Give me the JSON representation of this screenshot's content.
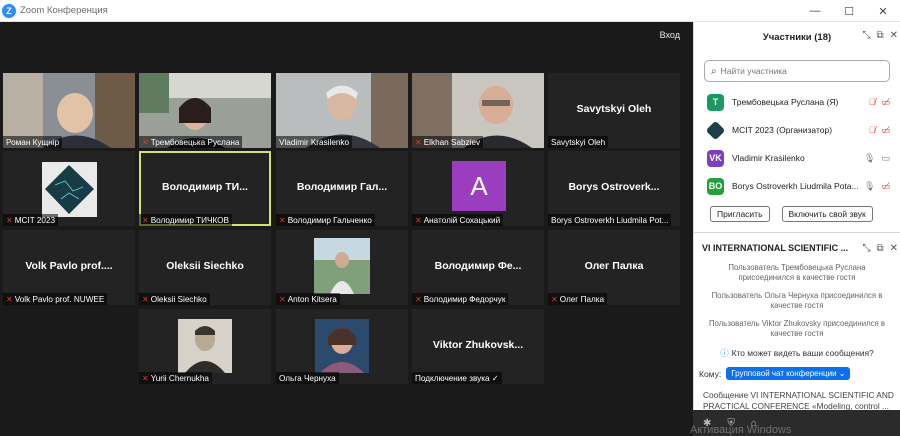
{
  "window": {
    "title": "Zoom Конференция",
    "logo_letter": "Z"
  },
  "video": {
    "enter_label": "Вход",
    "tiles": [
      {
        "big": "",
        "label": "Роман Кущнір",
        "muted": false
      },
      {
        "big": "",
        "label": "Трембовецька Руслана",
        "muted": true
      },
      {
        "big": "",
        "label": "Vladimir Krasilenko",
        "muted": false
      },
      {
        "big": "",
        "label": "Elkhan Sabziev",
        "muted": true
      },
      {
        "big": "Savytskyi Oleh",
        "label": "Savytskyi Oleh",
        "muted": false
      },
      {
        "big": "",
        "label": "MCIT 2023",
        "muted": true
      },
      {
        "big": "Володимир  ТИ...",
        "label": "Володимир ТИЧКОВ",
        "muted": true
      },
      {
        "big": "Володимир  Гал...",
        "label": "Володимир Гальченко",
        "muted": true
      },
      {
        "big": "",
        "label": "Анатолій Сохацький",
        "muted": true
      },
      {
        "big": "Borys  Ostroverk...",
        "label": "Borys Ostroverkh Liudmila Pot...",
        "muted": false
      },
      {
        "big": "Volk  Pavlo  prof....",
        "label": "Volk Pavlo prof. NUWEE",
        "muted": true
      },
      {
        "big": "Oleksii  Siechko",
        "label": "Oleksii Siechko",
        "muted": true
      },
      {
        "big": "",
        "label": "Anton Kitsera",
        "muted": true
      },
      {
        "big": "Володимир  Фе...",
        "label": "Володимир Федорчук",
        "muted": true
      },
      {
        "big": "Олег  Палка",
        "label": "Олег Палка",
        "muted": true
      },
      {
        "big": "",
        "label": "Yurii Chernukha",
        "muted": true
      },
      {
        "big": "",
        "label": "Ольга Чернуха",
        "muted": false
      },
      {
        "big": "Viktor  Zhukovsk...",
        "label": "Подключение звука ✓",
        "muted": false
      }
    ],
    "avatar_letter": "A"
  },
  "participants": {
    "title": "Участники (18)",
    "search_placeholder": "Найти участника",
    "items": [
      {
        "initials": "T",
        "name": "Трембовецька Руслана (Я)",
        "color": "#1b9a5f"
      },
      {
        "initials": "",
        "name": "MCIT 2023 (Организатор)",
        "color": "#1f3f4a"
      },
      {
        "initials": "VK",
        "name": "Vladimir Krasilenko",
        "color": "#7d3fbf"
      },
      {
        "initials": "BO",
        "name": "Borys Ostroverkh Liudmila Pota...",
        "color": "#22a33a"
      }
    ],
    "invite_label": "Пригласить",
    "unmute_label": "Включить свой звук"
  },
  "chat": {
    "title": "VI INTERNATIONAL SCIENTIFIC ...",
    "messages": [
      "Пользователь Трембовецька Руслана присоединился в качестве гостя",
      "Пользователь Ольга Чернуха присоединился в качестве гостя",
      "Пользователь Viktor Zhukovsky присоединился в качестве гостя"
    ],
    "who_sees": "Кто может видеть ваши сообщения?",
    "to_label": "Кому:",
    "to_value": "Групповой чат конференции ⌄",
    "input_text": "Сообщение VI INTERNATIONAL SCIENTIFIC AND PRACTICAL CONFERENCE  «Modeling, control ..."
  },
  "watermark": "Активация Windows"
}
